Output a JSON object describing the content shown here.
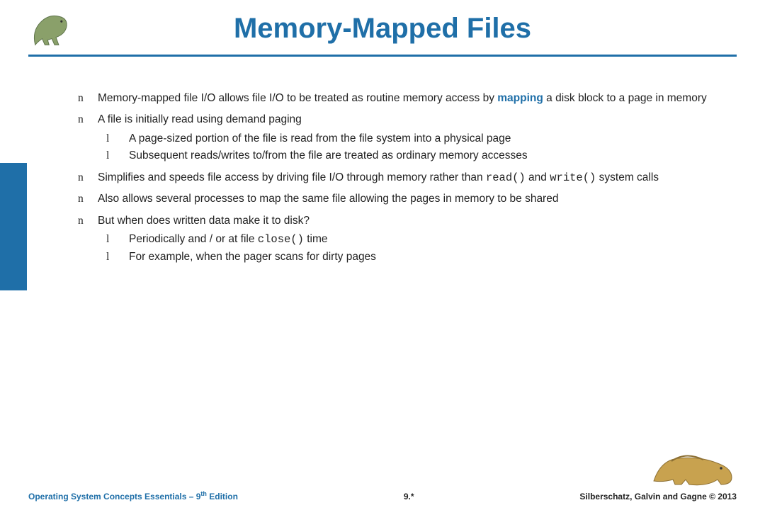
{
  "title": "Memory-Mapped Files",
  "bullets": [
    {
      "pre": "Memory-mapped file I/O allows file I/O to be treated as routine memory access by ",
      "kw": "mapping",
      "post": " a disk block to a page in memory"
    },
    {
      "text": "A file is initially read using demand paging",
      "sub": [
        {
          "text": "A page-sized portion of the file is read from the file system into a physical page"
        },
        {
          "text": "Subsequent reads/writes to/from the file are treated as ordinary memory accesses"
        }
      ]
    },
    {
      "pre": "Simplifies and speeds file access by driving file I/O through memory rather than ",
      "code1": "read()",
      "mid": " and ",
      "code2": "write()",
      "post": " system calls"
    },
    {
      "text": "Also allows several processes to map the same file allowing the pages in memory to be shared"
    },
    {
      "text": "But when does written data make it to disk?",
      "sub": [
        {
          "pre": "Periodically and / or at file ",
          "code1": "close()",
          "post": " time"
        },
        {
          "text": "For example, when the pager scans for dirty pages"
        }
      ]
    }
  ],
  "marks": {
    "l1": "n",
    "l2": "l"
  },
  "footer": {
    "left_a": "Operating System Concepts Essentials – 9",
    "left_sup": "th",
    "left_b": " Edition",
    "mid": "9.*",
    "right": "Silberschatz, Galvin and Gagne © 2013"
  },
  "icons": {
    "dino_top": "dinosaur-icon",
    "dino_bot": "dinosaur-icon"
  }
}
